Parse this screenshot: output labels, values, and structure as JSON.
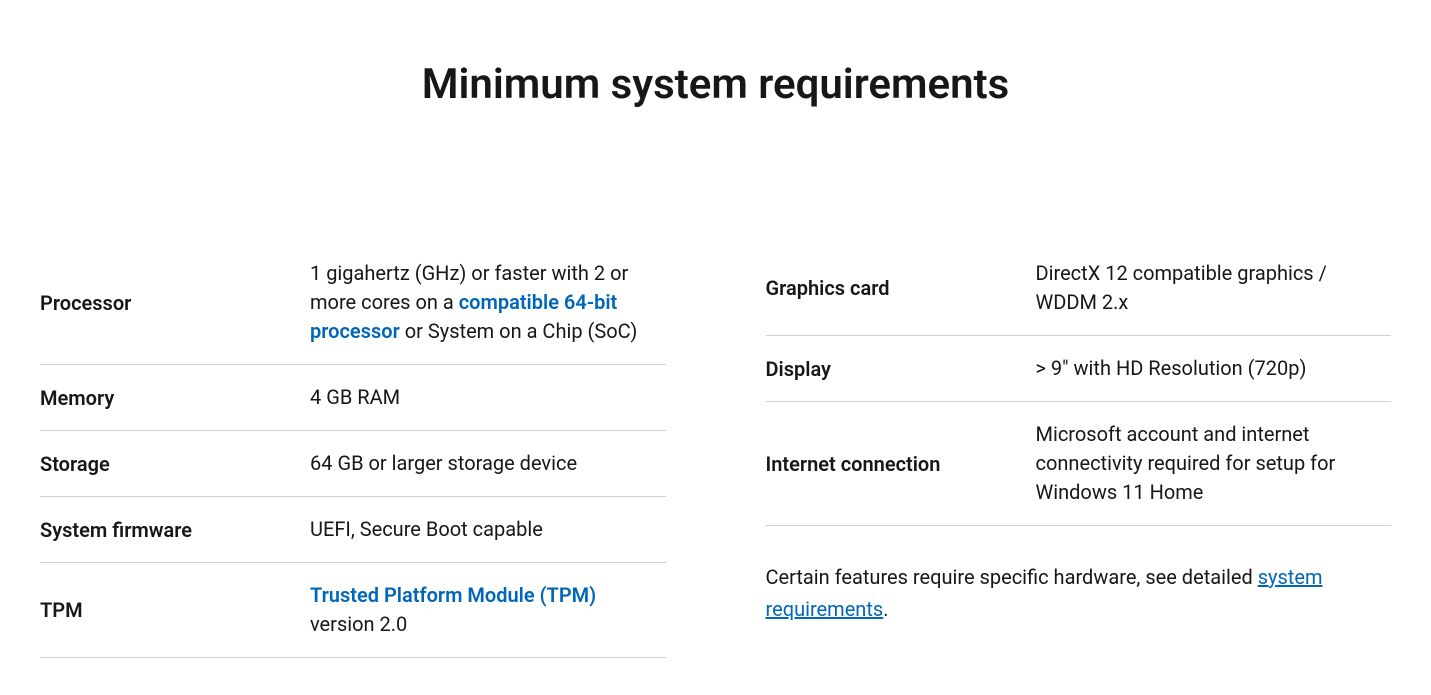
{
  "title": "Minimum system requirements",
  "left": {
    "rows": [
      {
        "label": "Processor",
        "pre": "1 gigahertz (GHz) or faster with 2 or more cores on a ",
        "link": "compatible 64-bit processor",
        "post": " or System on a Chip (SoC)"
      },
      {
        "label": "Memory",
        "value": "4 GB RAM"
      },
      {
        "label": "Storage",
        "value": "64 GB or larger storage device"
      },
      {
        "label": "System firmware",
        "value": "UEFI, Secure Boot capable"
      },
      {
        "label": "TPM",
        "link": "Trusted Platform Module (TPM)",
        "post": " version 2.0"
      }
    ]
  },
  "right": {
    "rows": [
      {
        "label": "Graphics card",
        "value": "DirectX 12 compatible graphics / WDDM 2.x"
      },
      {
        "label": "Display",
        "value": "> 9\" with HD Resolution (720p)"
      },
      {
        "label": "Internet connection",
        "value": "Microsoft account and internet connectivity required for setup for Windows 11 Home"
      }
    ]
  },
  "footnote": {
    "pre": "Certain features require specific hardware, see detailed ",
    "link": "system requirements",
    "post": "."
  }
}
